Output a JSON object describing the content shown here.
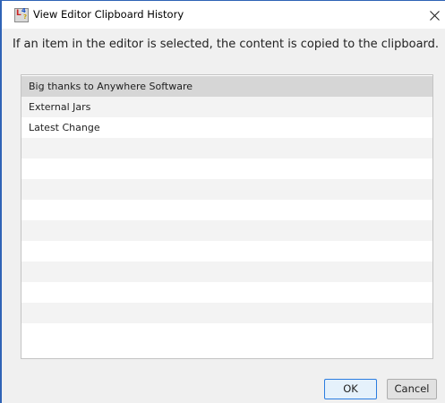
{
  "window": {
    "title": "View Editor Clipboard History",
    "close_glyph": "✕",
    "app_icon": "b4j-app-icon"
  },
  "instruction": "If an item in the editor is selected, the content is copied to the clipboard.",
  "list": {
    "items": [
      "Big thanks to Anywhere Software",
      "External Jars",
      "Latest Change"
    ],
    "selected_index": 0
  },
  "buttons": {
    "ok": "OK",
    "cancel": "Cancel"
  },
  "colors": {
    "accent_border": "#2f63b6",
    "selected_row": "#d6d6d6",
    "ok_border": "#2b7de0"
  }
}
